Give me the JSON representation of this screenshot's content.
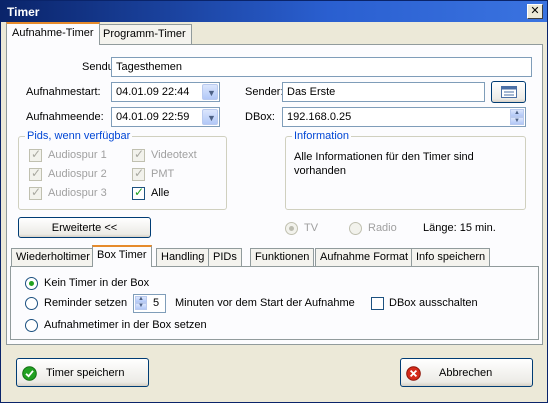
{
  "window": {
    "title": "Timer",
    "close": "✕"
  },
  "top_tabs": [
    "Aufnahme-Timer",
    "Programm-Timer"
  ],
  "form": {
    "sendung_label": "Sendung:",
    "sendung_value": "Tagesthemen",
    "start_label": "Aufnahmestart:",
    "start_value": "04.01.09 22:44",
    "ende_label": "Aufnahmeende:",
    "ende_value": "04.01.09 22:59",
    "sender_label": "Sender:",
    "sender_value": "Das Erste",
    "dbox_label": "DBox:",
    "dbox_value": "192.168.0.25"
  },
  "pids": {
    "title": "Pids, wenn verfügbar",
    "items": [
      {
        "label": "Audiospur 1",
        "checked": true,
        "enabled": false
      },
      {
        "label": "Audiospur 2",
        "checked": true,
        "enabled": false
      },
      {
        "label": "Audiospur 3",
        "checked": true,
        "enabled": false
      },
      {
        "label": "Videotext",
        "checked": true,
        "enabled": false
      },
      {
        "label": "PMT",
        "checked": true,
        "enabled": false
      },
      {
        "label": "Alle",
        "checked": true,
        "enabled": true
      }
    ]
  },
  "info": {
    "title": "Information",
    "text": "Alle Informationen für den Timer sind vorhanden"
  },
  "extended_button": "Erweiterte <<",
  "mode": {
    "tv": "TV",
    "radio": "Radio",
    "selected": "tv",
    "length": "Länge: 15 min."
  },
  "sub_tabs": [
    "Wiederholtimer",
    "Box Timer",
    "Handling",
    "PIDs",
    "Funktionen",
    "Aufnahme Format",
    "Info speichern"
  ],
  "box_timer": {
    "option_none": "Kein Timer in der Box",
    "option_reminder": "Reminder setzen",
    "option_record": "Aufnahmetimer in der Box setzen",
    "selected": "none",
    "minutes_value": "5",
    "minutes_text": "Minuten vor dem Start der Aufnahme",
    "dbox_off": "DBox ausschalten",
    "dbox_off_checked": false
  },
  "buttons": {
    "save": "Timer speichern",
    "cancel": "Abbrechen"
  },
  "colors": {
    "accent": "#0046d5",
    "tab_highlight": "#e68b2c",
    "ok_green": "#21a121",
    "cancel_red": "#d42a1a"
  }
}
